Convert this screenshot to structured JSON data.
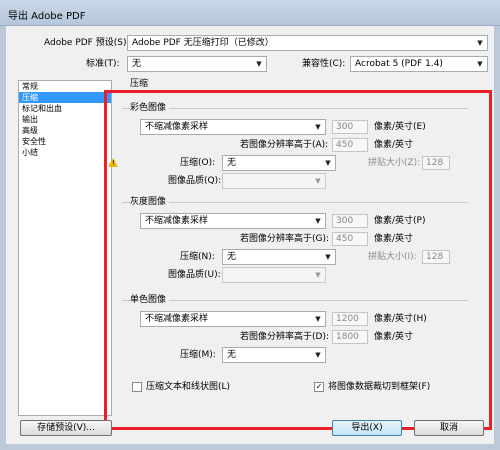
{
  "window": {
    "title": "导出 Adobe PDF"
  },
  "top": {
    "preset_label": "Adobe PDF 预设(S):",
    "preset_value": "Adobe PDF 无压缩打印（已修改）",
    "standard_label": "标准(T):",
    "standard_value": "无",
    "compat_label": "兼容性(C):",
    "compat_value": "Acrobat 5 (PDF 1.4)"
  },
  "sidebar": {
    "items": [
      {
        "label": "常规"
      },
      {
        "label": "压缩"
      },
      {
        "label": "标记和出血"
      },
      {
        "label": "输出"
      },
      {
        "label": "高级"
      },
      {
        "label": "安全性"
      },
      {
        "label": "小结"
      }
    ]
  },
  "panel": {
    "title": "压缩"
  },
  "color": {
    "title": "彩色图像",
    "sampling": "不缩减像素采样",
    "res_value": "300",
    "res_unit": "像素/英寸(E)",
    "above_label": "若图像分辨率高于(A):",
    "above_value": "450",
    "above_unit": "像素/英寸",
    "compress_label": "压缩(O):",
    "compress_value": "无",
    "tile_label": "拼贴大小(Z):",
    "tile_value": "128",
    "quality_label": "图像品质(Q):",
    "quality_value": ""
  },
  "gray": {
    "title": "灰度图像",
    "sampling": "不缩减像素采样",
    "res_value": "300",
    "res_unit": "像素/英寸(P)",
    "above_label": "若图像分辨率高于(G):",
    "above_value": "450",
    "above_unit": "像素/英寸",
    "compress_label": "压缩(N):",
    "compress_value": "无",
    "tile_label": "拼贴大小(I):",
    "tile_value": "128",
    "quality_label": "图像品质(U):",
    "quality_value": ""
  },
  "mono": {
    "title": "单色图像",
    "sampling": "不缩减像素采样",
    "res_value": "1200",
    "res_unit": "像素/英寸(H)",
    "above_label": "若图像分辨率高于(D):",
    "above_value": "1800",
    "above_unit": "像素/英寸",
    "compress_label": "压缩(M):",
    "compress_value": "无"
  },
  "options": {
    "compress_text": "压缩文本和线状图(L)",
    "crop_images": "将图像数据裁切到框架(F)",
    "crop_checked": true,
    "compress_checked": false
  },
  "buttons": {
    "save_preset": "存储预设(V)...",
    "export": "导出(X)",
    "cancel": "取消"
  },
  "colors": {
    "highlight": "#e8202a",
    "selection": "#3399ff"
  }
}
